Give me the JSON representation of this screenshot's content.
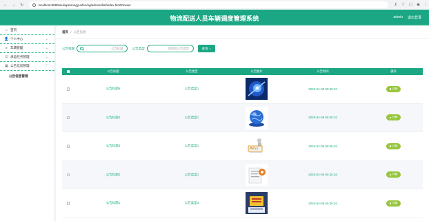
{
  "browser": {
    "url": "localhost:8080/wuliupeisongyunfen/ng/admin/dist/index.html#/news"
  },
  "header": {
    "title": "物流配送人员车辆调度管理系统",
    "user": "admin",
    "logout": "退出登录"
  },
  "sidebar": {
    "items": [
      {
        "label": "首页",
        "icon": "home-icon"
      },
      {
        "label": "个人中心",
        "icon": "user-icon"
      },
      {
        "label": "车辆管理",
        "icon": "list-icon"
      },
      {
        "label": "承运任务管理",
        "icon": "edit-icon"
      },
      {
        "label": "公告信息管理",
        "icon": "grid-icon"
      }
    ],
    "sub_items": [
      {
        "label": "公告信息管理"
      }
    ]
  },
  "breadcrumb": {
    "home": "首页",
    "separator": "/",
    "current": "公告信息"
  },
  "search": {
    "title_label": "公告标题",
    "title_placeholder": "公告标题",
    "type_label": "公告类型",
    "type_placeholder": "请选择公告类型",
    "button_label": "查询"
  },
  "table": {
    "headers": [
      "公告标题",
      "公告类型",
      "公告图片",
      "公告时间",
      "操作"
    ],
    "rows": [
      {
        "title": "公告标题5",
        "type": "公告类型1",
        "image": "tech-blue",
        "time": "2025-04-08 00:36:16",
        "action": "详情"
      },
      {
        "title": "公告标题4",
        "type": "公告类型1",
        "image": "globe",
        "time": "2025-04-08 00:36:16",
        "action": "详情"
      },
      {
        "title": "公告标题3",
        "type": "公告类型1",
        "image": "news-figure",
        "time": "2025-04-08 00:36:16",
        "action": "详情"
      },
      {
        "title": "公告标题2",
        "type": "公告类型1",
        "image": "document",
        "time": "2025-04-08 00:36:16",
        "action": "详情"
      },
      {
        "title": "公告标题1",
        "type": "公告类型3",
        "image": "news-board",
        "time": "2025-04-08 00:36:16",
        "action": "详情"
      }
    ]
  },
  "colors": {
    "primary": "#1ba784",
    "detail_button": "#97c73c"
  }
}
